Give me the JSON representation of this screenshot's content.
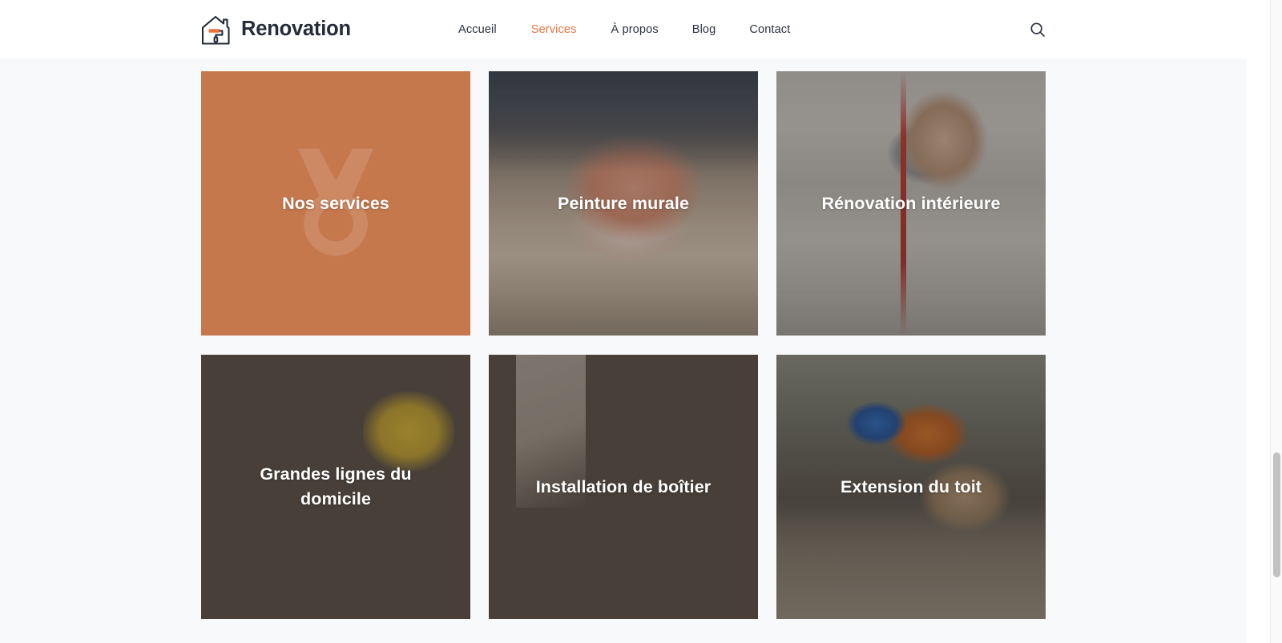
{
  "header": {
    "brand": {
      "name": "Renovation",
      "logo_icon": "house-paint-roller-icon"
    },
    "nav": [
      {
        "label": "Accueil",
        "active": false
      },
      {
        "label": "Services",
        "active": true
      },
      {
        "label": "À propos",
        "active": false
      },
      {
        "label": "Blog",
        "active": false
      },
      {
        "label": "Contact",
        "active": false
      }
    ],
    "search_icon": "search-icon"
  },
  "services": {
    "tiles": [
      {
        "title": "Nos services",
        "kind": "solid",
        "watermark_icon": "medal-award-icon"
      },
      {
        "title": "Peinture murale",
        "kind": "photo",
        "photo": "paint-pouring-from-can"
      },
      {
        "title": "Rénovation intérieure",
        "kind": "photo",
        "photo": "worker-with-respirator-mask"
      },
      {
        "title": "Grandes lignes du domicile",
        "kind": "photo",
        "photo": "man-using-miter-saw"
      },
      {
        "title": "Installation de boîtier",
        "kind": "photo",
        "photo": "hand-with-drill-on-wood"
      },
      {
        "title": "Extension du toit",
        "kind": "photo",
        "photo": "roofer-with-blue-helmet"
      }
    ]
  },
  "colors": {
    "accent_orange": "#e8743c",
    "tile_orange": "#c5784c",
    "brand_dark": "#242c3a",
    "page_background": "#f8f9fa",
    "header_background": "#ffffff"
  }
}
